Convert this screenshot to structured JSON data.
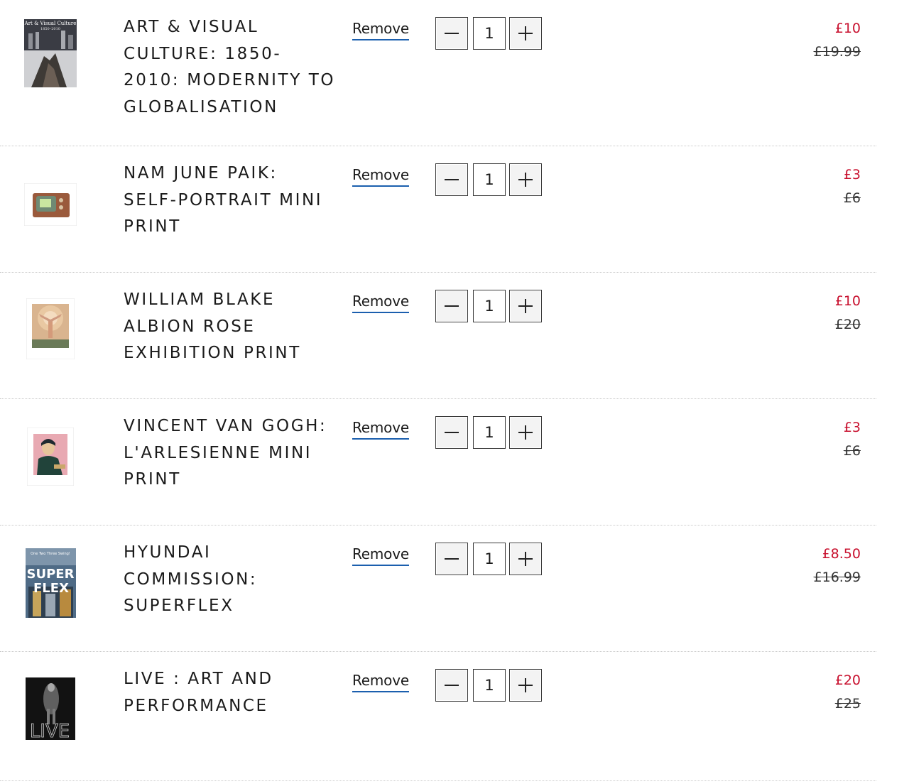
{
  "cart": {
    "remove_label": "Remove",
    "colors": {
      "sale_price": "#c8102e",
      "remove_underline": "#1b5fae"
    },
    "items": [
      {
        "title": "ART & VISUAL CULTURE: 1850-2010: MODERNITY TO GLOBALISATION",
        "thumb": "book-cover-art-visual-culture",
        "quantity": "1",
        "price_now": "£10",
        "price_was": "£19.99"
      },
      {
        "title": "NAM JUNE PAIK: SELF-PORTRAIT MINI PRINT",
        "thumb": "print-tv-set",
        "quantity": "1",
        "price_now": "£3",
        "price_was": "£6"
      },
      {
        "title": "WILLIAM BLAKE ALBION ROSE EXHIBITION PRINT",
        "thumb": "print-albion-rose",
        "quantity": "1",
        "price_now": "£10",
        "price_was": "£20"
      },
      {
        "title": "VINCENT VAN GOGH: L'ARLESIENNE MINI PRINT",
        "thumb": "print-arlesienne",
        "quantity": "1",
        "price_now": "£3",
        "price_was": "£6"
      },
      {
        "title": "HYUNDAI COMMISSION: SUPERFLEX",
        "thumb": "book-cover-superflex",
        "quantity": "1",
        "price_now": "£8.50",
        "price_was": "£16.99"
      },
      {
        "title": "LIVE : ART AND PERFORMANCE",
        "thumb": "book-cover-live",
        "quantity": "1",
        "price_now": "£20",
        "price_was": "£25"
      }
    ],
    "thumb_text": {
      "art_visual": "Art & Visual Culture",
      "art_visual_years": "1850–2010",
      "superflex_top": "One Two Three Swing!",
      "superflex_1": "SUPER",
      "superflex_2": "FLEX",
      "live": "LIVE"
    },
    "icons": {
      "minus": "minus-icon",
      "plus": "plus-icon"
    }
  }
}
